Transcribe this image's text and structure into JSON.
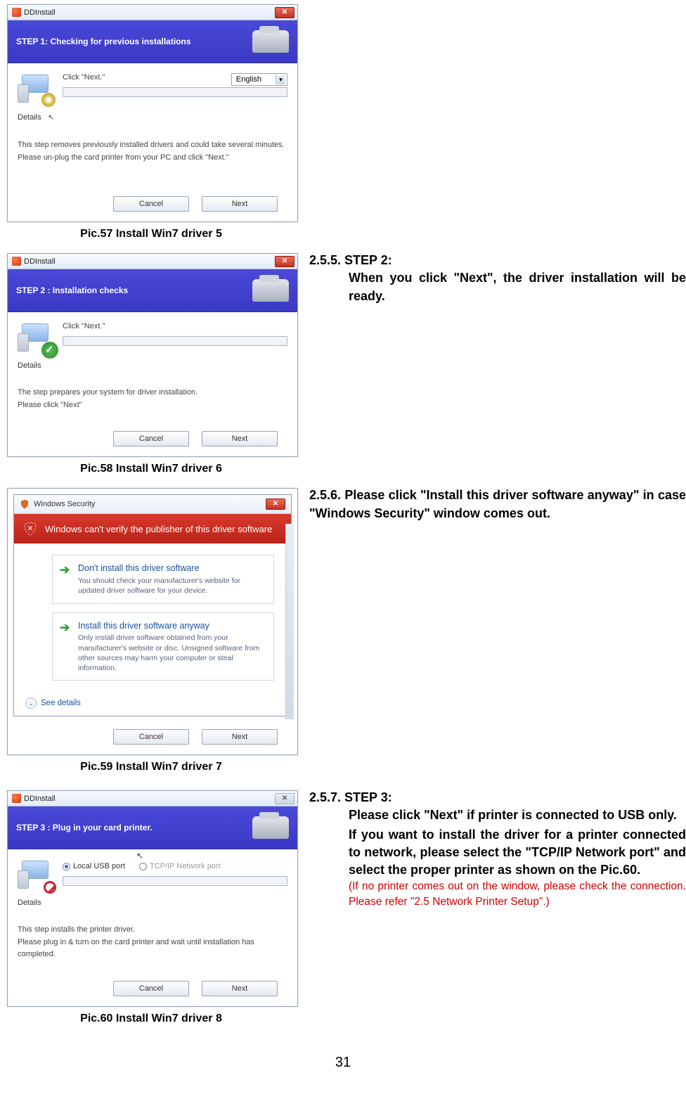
{
  "captions": {
    "c57": "Pic.57    Install Win7 driver 5",
    "c58": "Pic.58    Install Win7 driver 6",
    "c59": "Pic.59    Install Win7 driver 7",
    "c60": "Pic.60    Install Win7 driver 8"
  },
  "dialog_common": {
    "title": "DDInstall",
    "close_glyph": "✕",
    "details_label": "Details",
    "cancel": "Cancel",
    "next": "Next"
  },
  "dialog57": {
    "step": "STEP 1: Checking for previous installations",
    "instr": "Click \"Next.\"",
    "lang": "English",
    "note1": "This step removes previously installed drivers and could take several minutes.",
    "note2": "Please un-plug the card printer from your PC and click \"Next.\""
  },
  "dialog58": {
    "step": "STEP 2 :   Installation checks",
    "instr": "Click \"Next.\"",
    "note1": "The step prepares your system for driver installation.",
    "note2": "Please click \"Next\""
  },
  "security": {
    "win_title": "Windows Security",
    "banner": "Windows can't verify the publisher of this driver software",
    "opt1_title": "Don't install this driver software",
    "opt1_sub": "You should check your manufacturer's website for updated driver software for your device.",
    "opt2_title": "Install this driver software anyway",
    "opt2_sub": "Only install driver software obtained from your manufacturer's website or disc. Unsigned software from other sources may harm your computer or steal information.",
    "see_details": "See details"
  },
  "dialog60": {
    "step": "STEP 3 :   Plug in your card printer.",
    "radio1": "Local USB port",
    "radio2": "TCP/IP Network port",
    "note1": "This step installs the printer driver.",
    "note2": "Please plug in & turn on the card printer and wait until installation has completed."
  },
  "text": {
    "s255_head": "2.5.5. STEP 2:",
    "s255_body": "When you click \"Next\", the driver installation will be ready.",
    "s256": "2.5.6. Please click \"Install this driver software anyway\" in case \"Windows Security\" window comes out.",
    "s257_head": "2.5.7. STEP 3:",
    "s257_b1": "Please click \"Next\" if printer is connected to USB only.",
    "s257_b2": "If you want to install the driver for a printer connected to network, please select the \"TCP/IP Network port\" and select the proper printer as shown on the Pic.60.",
    "s257_red": "(If no printer comes out on the window, please check the connection. Please refer \"2.5 Network Printer Setup\".)"
  },
  "page_number": "31"
}
